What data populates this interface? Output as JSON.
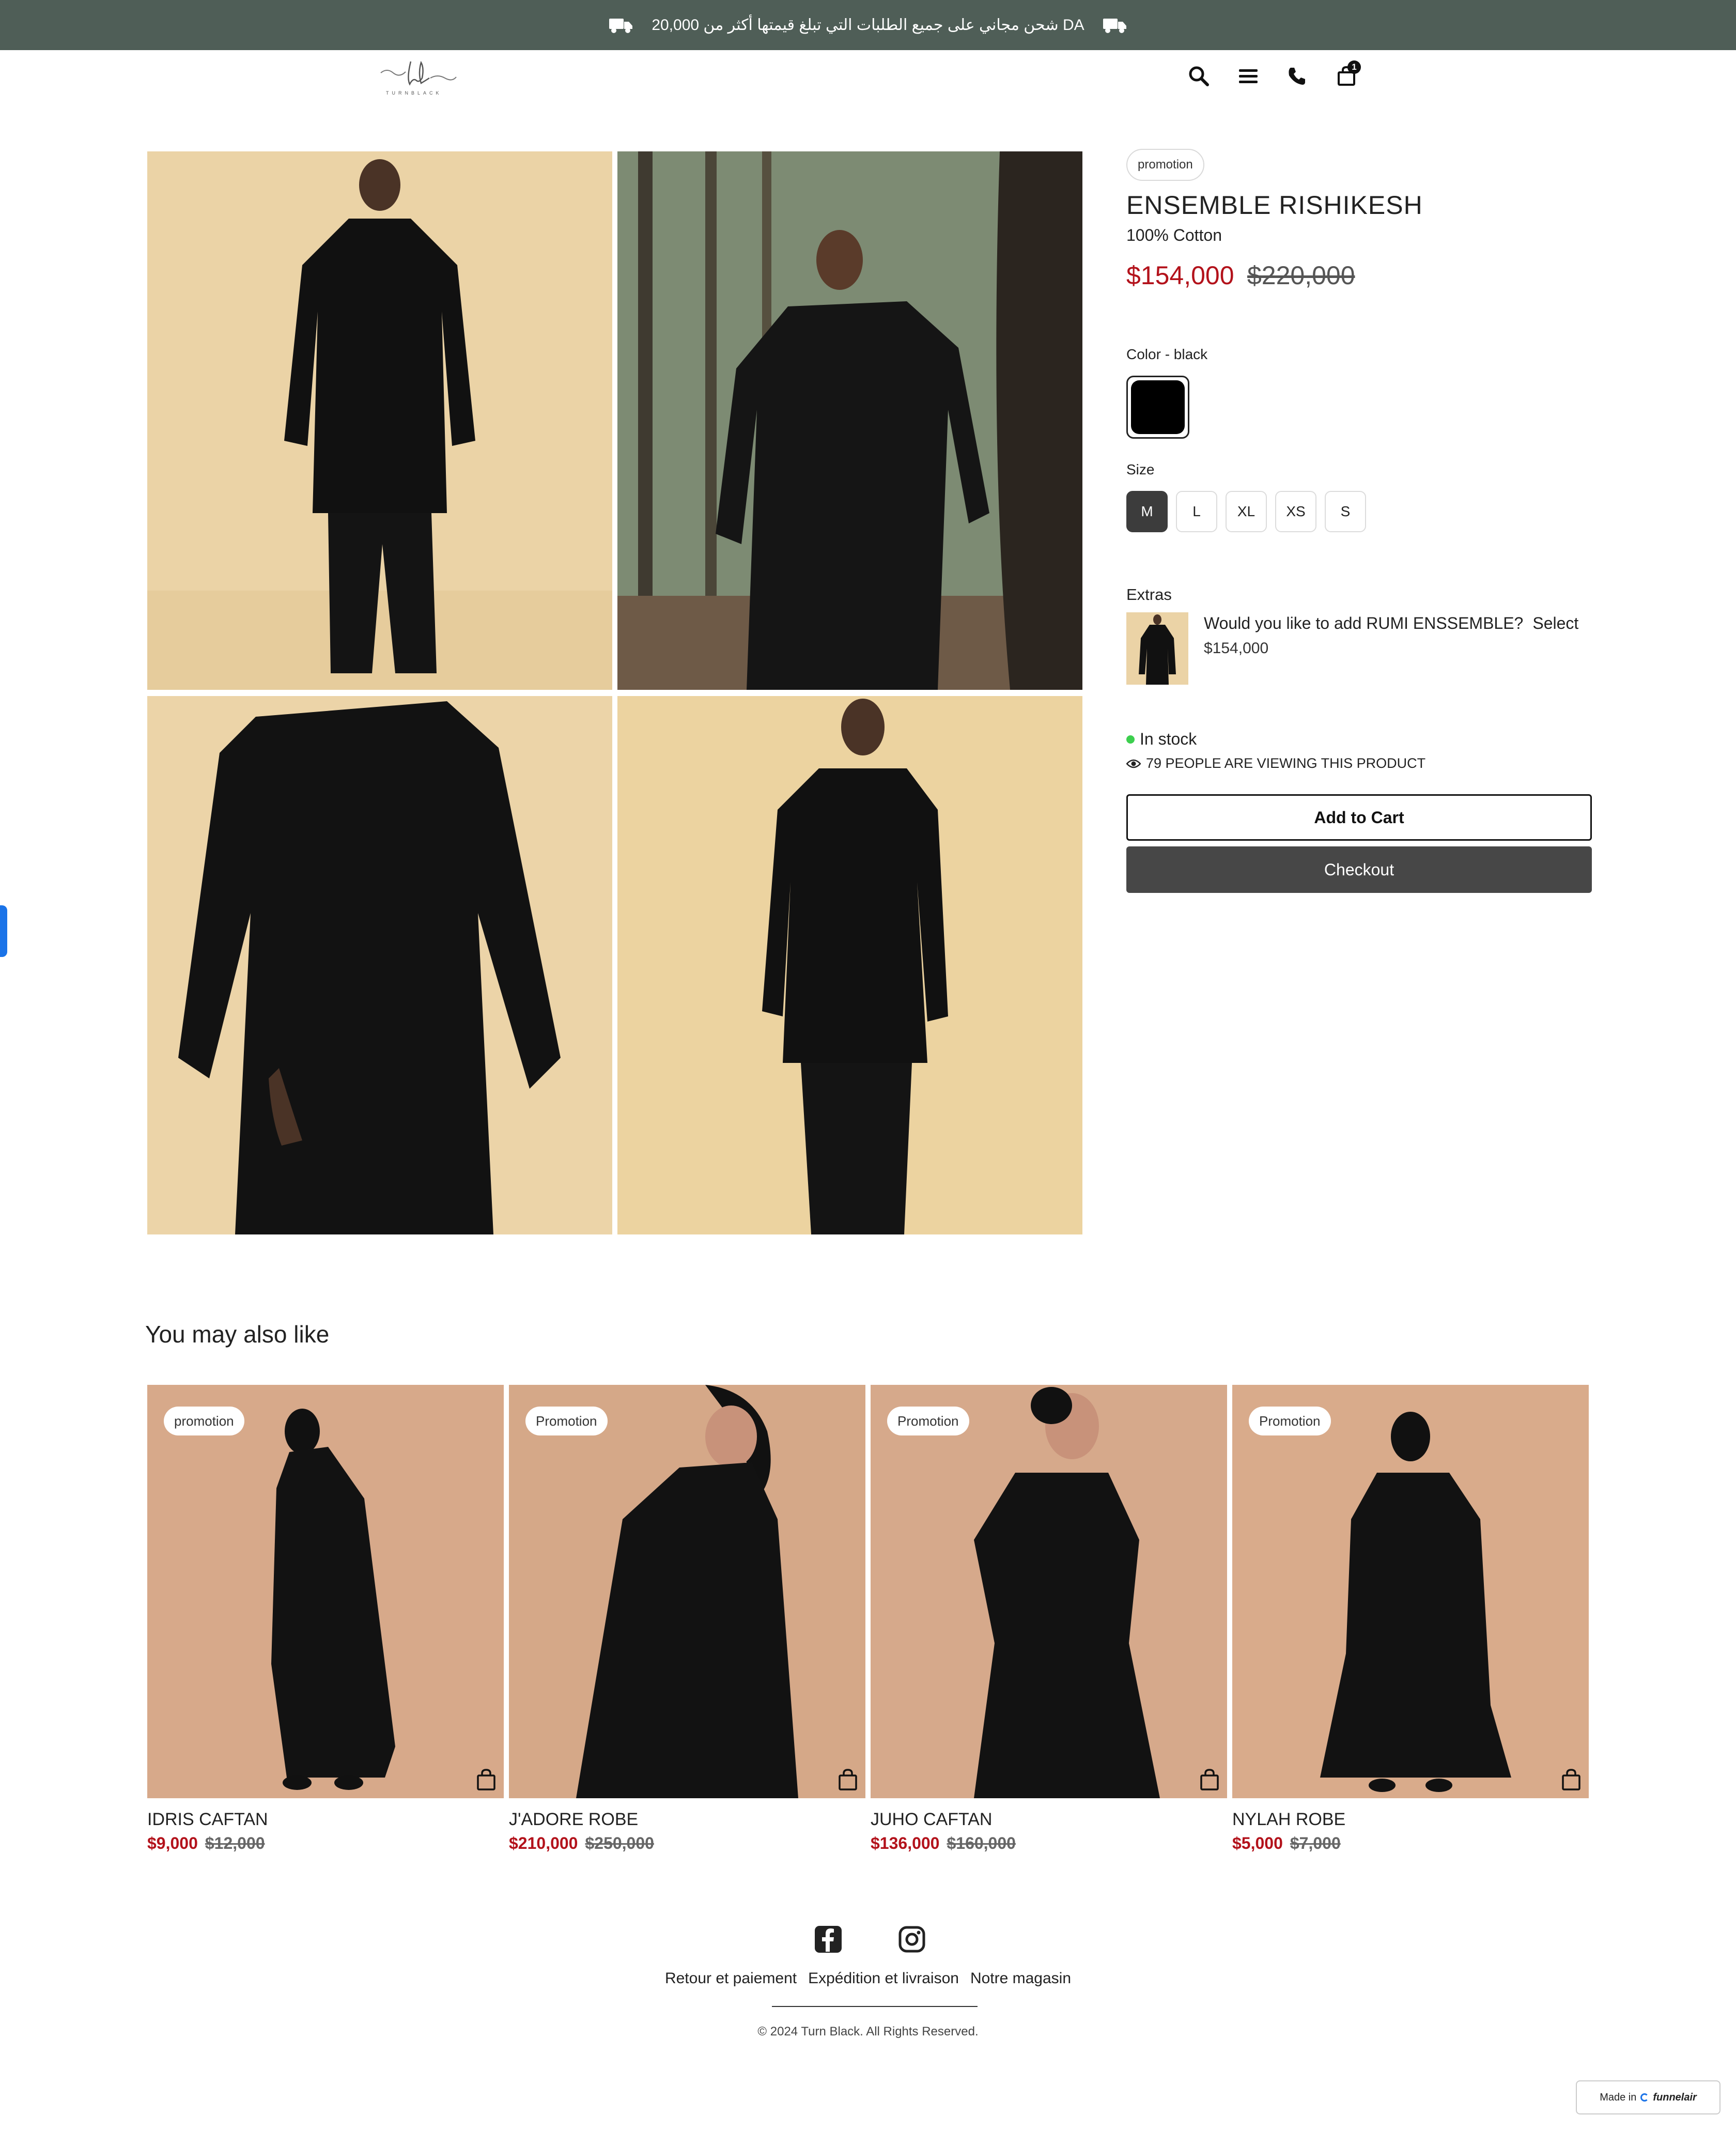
{
  "announcement": {
    "text": "شحن مجاني على جميع الطلبات التي تبلغ قيمتها أكثر من 20,000 DA"
  },
  "product": {
    "badge": "promotion",
    "title": "ENSEMBLE RISHIKESH",
    "subtitle": "100% Cotton",
    "price": "$154,000",
    "old_price": "$220,000",
    "color_label": "Color - black",
    "color_swatch": "#000000",
    "size_label": "Size",
    "sizes": [
      "M",
      "L",
      "XL",
      "XS",
      "S"
    ],
    "selected_size": "M",
    "extras_label": "Extras",
    "extra": {
      "question": "Would you like to add RUMI ENSSEMBLE?",
      "select_label": "Select",
      "price": "$154,000"
    },
    "stock": "In stock",
    "viewing": "79 PEOPLE ARE VIEWING THIS PRODUCT",
    "add_to_cart": "Add to Cart",
    "checkout": "Checkout"
  },
  "header": {
    "cart_count": "1"
  },
  "related": {
    "title": "You may also like",
    "items": [
      {
        "badge": "promotion",
        "name": "IDRIS CAFTAN",
        "price": "$9,000",
        "old_price": "$12,000"
      },
      {
        "badge": "Promotion",
        "name": "J'ADORE ROBE",
        "price": "$210,000",
        "old_price": "$250,000"
      },
      {
        "badge": "Promotion",
        "name": "JUHO CAFTAN",
        "price": "$136,000",
        "old_price": "$160,000"
      },
      {
        "badge": "Promotion",
        "name": "NYLAH ROBE",
        "price": "$5,000",
        "old_price": "$7,000"
      }
    ]
  },
  "footer": {
    "links": [
      "Retour et paiement",
      "Expédition et livraison",
      "Notre magasin"
    ],
    "copyright": "© 2024 Turn Black. All Rights Reserved."
  },
  "badge_madein": {
    "prefix": "Made in",
    "brand": "funnelair"
  },
  "colors": {
    "topbar_bg": "#4f5e57",
    "sale_red": "#b3121b",
    "checkout_bg": "#474747",
    "stock_green": "#3ccf4e"
  }
}
